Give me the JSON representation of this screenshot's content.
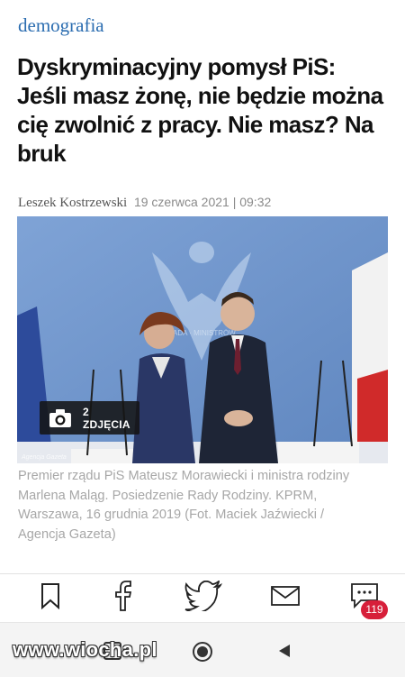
{
  "category": "demografia",
  "headline": {
    "lines": [
      "Dyskryminacyjny pomysł PiS:",
      "Jeśli masz żonę, nie będzie można",
      "cię zwolnić z pracy. Nie masz? Na",
      "bruk"
    ]
  },
  "byline": {
    "author": "Leszek Kostrzewski",
    "date": "19 czerwca 2021 | 09:32"
  },
  "photo": {
    "gallery_label": "2 ZDJĘCIA",
    "credit": "Agencja Gazeta"
  },
  "caption": {
    "lines": [
      "Premier rządu PiS Mateusz Morawiecki i ministra rodziny",
      "Marlena Maląg. Posiedzenie Rady Rodziny. KPRM,",
      "Warszawa, 16 grudnia 2019 (Fot. Maciek Jaźwiecki /",
      "Agencja Gazeta)"
    ]
  },
  "share_bar": {
    "icons": [
      "bookmark-icon",
      "facebook-icon",
      "twitter-icon",
      "email-icon",
      "comments-icon"
    ],
    "comments_count": "119"
  },
  "navbar": {
    "icons": [
      "square-icon",
      "home-circle-icon",
      "back-triangle-icon"
    ]
  },
  "watermark": "www.wiocha.pl",
  "colors": {
    "accent": "#2a6cb0",
    "badge": "#d71f3a",
    "caption_gray": "#a7a7a7"
  }
}
